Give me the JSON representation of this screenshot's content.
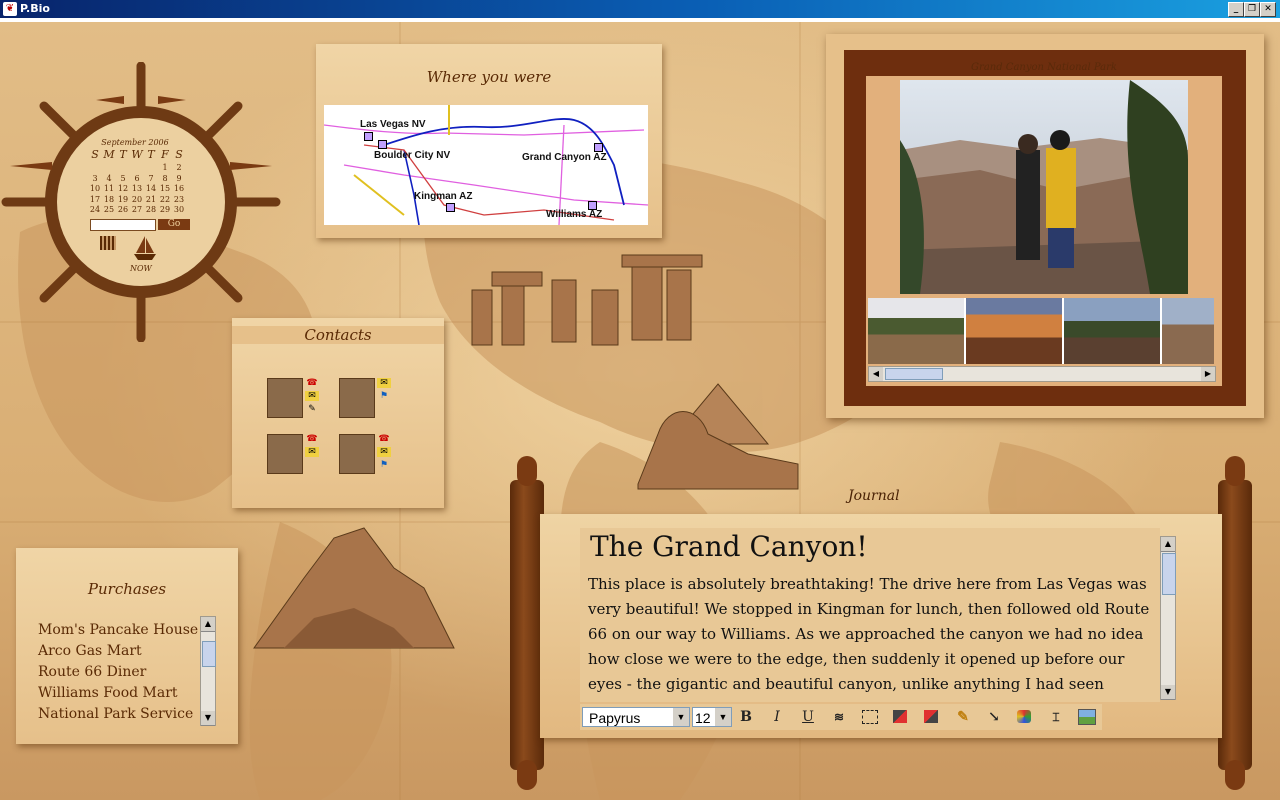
{
  "window": {
    "title": "P.Bio",
    "buttons": [
      "minimize",
      "maximize",
      "close"
    ]
  },
  "calendar": {
    "month_label": "September 2006",
    "weekday_headers": [
      "S",
      "M",
      "T",
      "W",
      "T",
      "F",
      "S"
    ],
    "days": [
      "",
      "",
      "",
      "",
      "",
      "1",
      "2",
      "3",
      "4",
      "5",
      "6",
      "7",
      "8",
      "9",
      "10",
      "11",
      "12",
      "13",
      "14",
      "15",
      "16",
      "17",
      "18",
      "19",
      "20",
      "21",
      "22",
      "23",
      "24",
      "25",
      "26",
      "27",
      "28",
      "29",
      "30"
    ],
    "go_label": "Go",
    "now_label": "NOW"
  },
  "map_widget": {
    "title": "Where you were",
    "cities": [
      "Las Vegas NV",
      "Boulder City NV",
      "Grand Canyon AZ",
      "Kingman AZ",
      "Williams AZ"
    ]
  },
  "contacts": {
    "title": "Contacts"
  },
  "purchases": {
    "title": "Purchases",
    "items": [
      "Mom's Pancake House",
      "Arco Gas Mart",
      "Route 66 Diner",
      "Williams Food Mart",
      "National Park Service"
    ]
  },
  "photo_frame": {
    "caption": "Grand Canyon National Park"
  },
  "journal": {
    "label": "Journal",
    "title": "The Grand Canyon!",
    "body": "This place is absolutely breathtaking!  The drive here from Las Vegas was very beautiful!  We stopped in Kingman for lunch, then followed old Route 66 on our way to Williams.  As we approached the canyon we had no idea how close we were to the edge, then suddenly it opened up before our eyes - the gigantic and beautiful canyon, unlike anything I had seen before!",
    "font_name": "Papyrus",
    "font_size": "12"
  },
  "colors": {
    "parchment": "#e6c08a",
    "dark_wood": "#6e2e0e",
    "ink": "#5a2a05"
  }
}
